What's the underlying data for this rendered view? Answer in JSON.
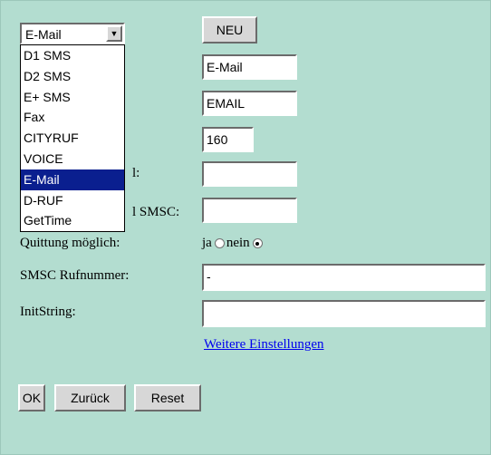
{
  "service_select": {
    "selected": "E-Mail",
    "options": [
      "D1 SMS",
      "D2 SMS",
      "E+ SMS",
      "Fax",
      "CITYRUF",
      "VOICE",
      "E-Mail",
      "D-RUF",
      "GetTime"
    ]
  },
  "new_button": "NEU",
  "fields": {
    "name_value": "E-Mail",
    "code_value": "EMAIL",
    "maxlen_value": "160",
    "field4_label_visible": "l:",
    "field4_value": "",
    "field5_label_visible": "l SMSC:",
    "field5_value": ""
  },
  "receipt": {
    "label": "Quittung möglich:",
    "yes": "ja",
    "no": "nein",
    "selected": "nein"
  },
  "smsc_number": {
    "label": "SMSC Rufnummer:",
    "value": "-"
  },
  "init_string": {
    "label": "InitString:",
    "value": ""
  },
  "more_settings_link": "Weitere Einstellungen",
  "buttons": {
    "ok": "OK",
    "back": "Zurück",
    "reset": "Reset"
  },
  "colors": {
    "background": "#b3ddd0",
    "selection": "#0a1f8f",
    "link": "#0000ee"
  }
}
